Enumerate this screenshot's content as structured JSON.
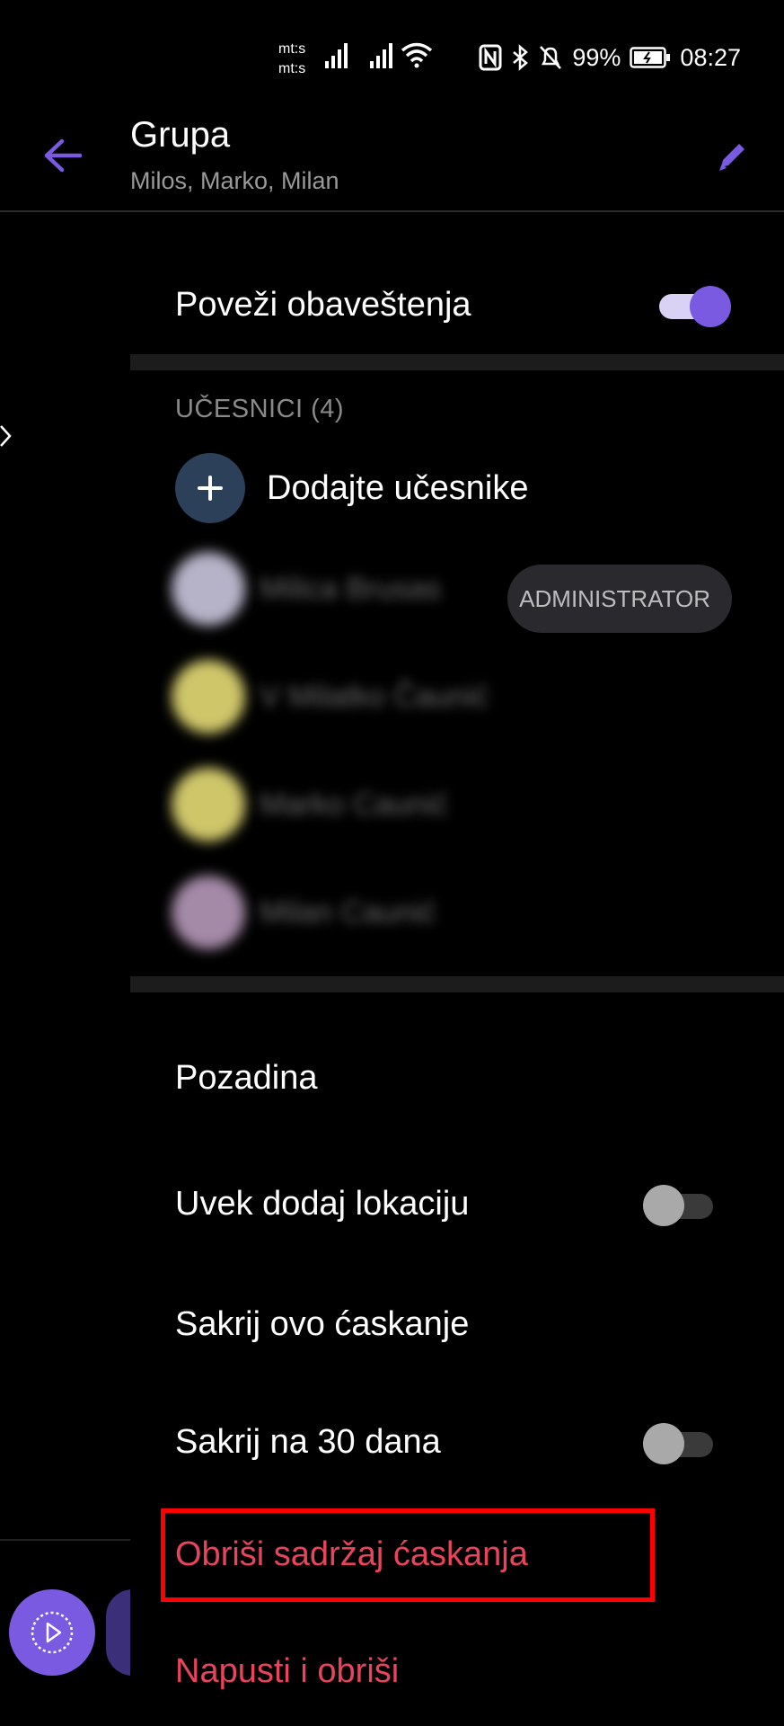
{
  "status_bar": {
    "carrier_1": "mt:s",
    "carrier_2": "mt:s",
    "battery": "99%",
    "time": "08:27"
  },
  "header": {
    "title": "Grupa",
    "subtitle": "Milos, Marko, Milan"
  },
  "settings": {
    "notifications_label": "Poveži obaveštenja",
    "notifications_on": true,
    "participants_header": "UČESNICI (4)",
    "add_participants_label": "Dodajte učesnike",
    "members": [
      {
        "name": "Milica Brusas"
      },
      {
        "name": "V Milatko Čaunić"
      },
      {
        "name": "Marko Caunić"
      },
      {
        "name": "Milan Caunić"
      }
    ],
    "admin_badge": "ADMINISTRATOR",
    "background_label": "Pozadina",
    "location_label": "Uvek dodaj lokaciju",
    "location_on": false,
    "hide_chat_label": "Sakrij ovo ćaskanje",
    "hide_30_label": "Sakrij na 30 dana",
    "hide_30_on": false,
    "delete_content_label": "Obriši sadržaj ćaskanja",
    "leave_delete_label": "Napusti i obriši"
  },
  "colors": {
    "accent": "#7a5ae0",
    "danger": "#e8455c",
    "highlight_box": "#ff0000",
    "background": "#000000"
  }
}
